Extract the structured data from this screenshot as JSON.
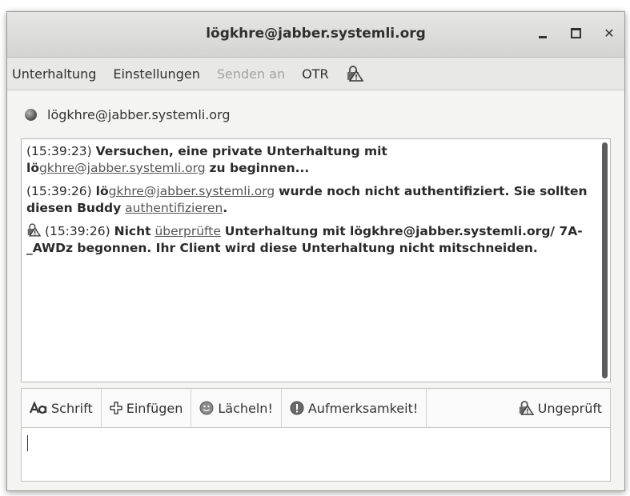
{
  "window": {
    "title": "lögkhre@jabber.systemli.org"
  },
  "menu": {
    "items": [
      {
        "label": "Unterhaltung",
        "disabled": false
      },
      {
        "label": "Einstellungen",
        "disabled": false
      },
      {
        "label": "Senden an",
        "disabled": true
      },
      {
        "label": "OTR",
        "disabled": false
      }
    ],
    "otr_status_icon": "unverified-lock-icon"
  },
  "buddy": {
    "name": "lögkhre@jabber.systemli.org",
    "status_icon": "status-dot-icon"
  },
  "messages": [
    {
      "time": "(15:39:23)",
      "pre": "Versuchen, eine private Unterhaltung mit",
      "prefix": "lö",
      "link": "gkhre@jabber.systemli.org",
      "post": "zu beginnen..."
    },
    {
      "time": "(15:39:26)",
      "prefix": "lö",
      "link": "gkhre@jabber.systemli.org",
      "mid": "wurde noch nicht authentifiziert. Sie sollten diesen Buddy",
      "link2": "authentifizieren",
      "end": "."
    },
    {
      "time": "(15:39:26)",
      "pre": "Nicht",
      "link": "überprüfte",
      "post": "Unterhaltung mit lögkhre@jabber.systemli.org/ 7A-_AWDz begonnen.  Ihr Client wird diese Unterhaltung nicht mitschneiden.",
      "icon": "unverified-lock-icon"
    }
  ],
  "toolbar": {
    "font": "Schrift",
    "insert": "Einfügen",
    "smile": "Lächeln!",
    "attention": "Aufmerksamkeit!",
    "unverified": "Ungeprüft"
  },
  "input": {
    "value": ""
  }
}
